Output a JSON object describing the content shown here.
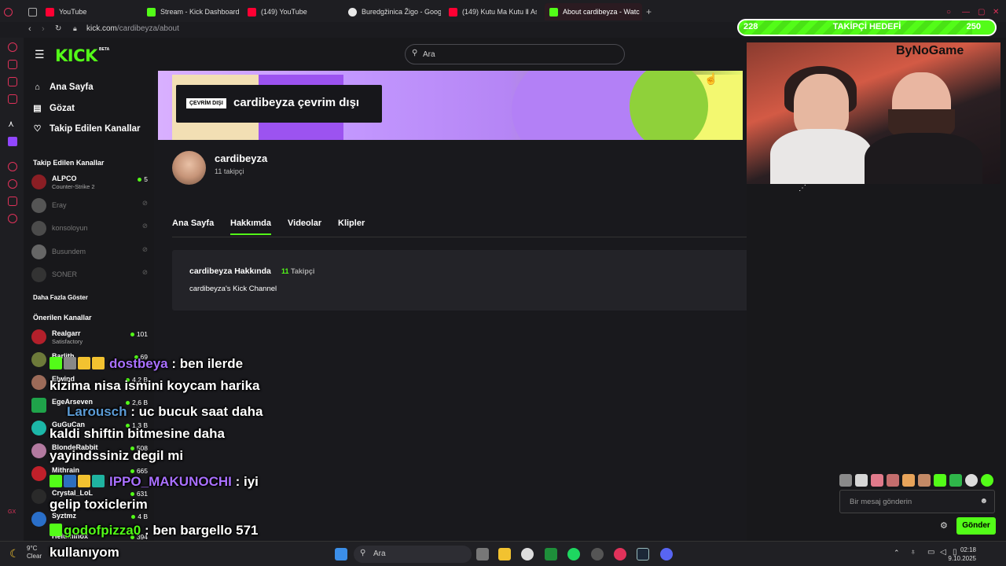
{
  "browser": {
    "tabs": [
      {
        "label": "YouTube",
        "color": "#ff0033"
      },
      {
        "label": "Stream - Kick Dashboard",
        "color": "#53fc18"
      },
      {
        "label": "(149) YouTube",
        "color": "#ff0033"
      },
      {
        "label": "Buredgžinica Žigo - Goog",
        "color": "#e8e8e8"
      },
      {
        "label": "(149) Kutu Ma Kutu Ⅱ Ash",
        "color": "#ff0033"
      },
      {
        "label": "About cardibeyza - Watc",
        "color": "#53fc18"
      }
    ],
    "url_host": "kick.com",
    "url_path": "/cardibeyza/about"
  },
  "header": {
    "logo": "KICK",
    "beta": "BETA",
    "search_placeholder": "Ara"
  },
  "sidebar": {
    "nav": [
      {
        "label": "Ana Sayfa",
        "icon": "home-icon"
      },
      {
        "label": "Gözat",
        "icon": "browse-icon"
      },
      {
        "label": "Takip Edilen Kanallar",
        "icon": "heart-icon"
      }
    ],
    "followed_title": "Takip Edilen Kanallar",
    "followed": [
      {
        "name": "ALPCO",
        "game": "Counter-Strike 2",
        "viewers": "5",
        "live": true
      },
      {
        "name": "Eray",
        "live": false
      },
      {
        "name": "konsoloyun",
        "live": false
      },
      {
        "name": "Busundem",
        "live": false
      },
      {
        "name": "SONER",
        "live": false
      }
    ],
    "show_more": "Daha Fazla Göster",
    "recommended_title": "Önerilen Kanallar",
    "recommended": [
      {
        "name": "Realgarr",
        "game": "Satisfactory",
        "viewers": "101"
      },
      {
        "name": "Barlith",
        "viewers": "69"
      },
      {
        "name": "Elwind",
        "viewers": "4,2 B"
      },
      {
        "name": "EgeArseven",
        "viewers": "2,6 B"
      },
      {
        "name": "GuGuCan",
        "viewers": "1,3 B"
      },
      {
        "name": "BlondeRabbit",
        "viewers": "508"
      },
      {
        "name": "Mithrain",
        "viewers": "665"
      },
      {
        "name": "Crystal_LoL",
        "viewers": "631"
      },
      {
        "name": "Syztmz",
        "viewers": "4 B"
      },
      {
        "name": "Heluminox",
        "viewers": "394"
      }
    ]
  },
  "channel": {
    "offline_badge": "ÇEVRİM DIŞI",
    "offline_text": "cardibeyza çevrim dışı",
    "name": "cardibeyza",
    "followers": "11 takipçi",
    "tabs": [
      "Ana Sayfa",
      "Hakkımda",
      "Videolar",
      "Klipler"
    ],
    "about_title": "cardibeyza Hakkında",
    "about_count": "11",
    "about_count_label": "Takipçi",
    "about_desc": "cardibeyza's Kick Channel"
  },
  "stream": {
    "goal_current": "228",
    "goal_title": "TAKİPÇİ HEDEFİ",
    "goal_target": "250",
    "goal_progress": 0.912,
    "brand": "ByNoGame",
    "chat_placeholder": "Bir mesaj gönderin",
    "send_label": "Gönder"
  },
  "chat_overlay": [
    {
      "user": "dostbeya",
      "user_color": "#a970ff",
      "text": ": ben ilerde"
    },
    {
      "text": "kizima nisa ismini koycam harika"
    },
    {
      "user": "Larousch",
      "user_color": "#5b9bd5",
      "text": ": uc bucuk saat daha"
    },
    {
      "text": "kaldi shiftin bitmesine daha"
    },
    {
      "text": "yayindssiniz degil mi"
    },
    {
      "user": "IPPO_MAKUNOCHI",
      "user_color": "#a970ff",
      "text": ": iyi"
    },
    {
      "text": "gelip toxiclerim"
    },
    {
      "user": "godofpizza0",
      "user_color": "#53fc18",
      "text": ": ben bargello 571"
    },
    {
      "text": "kullanıyom"
    }
  ],
  "taskbar": {
    "temp": "9°C",
    "weather": "Clear",
    "search": "Ara",
    "time": "02:18",
    "date": "9.10.2025"
  }
}
